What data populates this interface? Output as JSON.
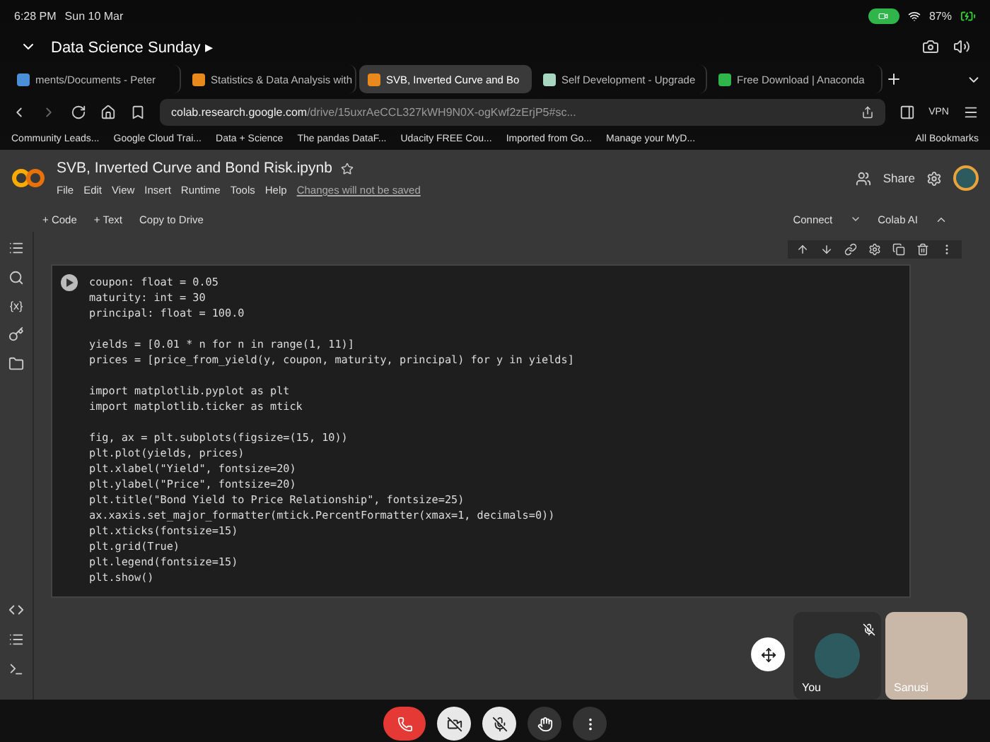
{
  "status_bar": {
    "time": "6:28 PM",
    "date": "Sun 10 Mar",
    "battery": "87%"
  },
  "meeting": {
    "title": "Data Science Sunday ▸"
  },
  "tabs": [
    {
      "label": "ments/Documents - Peter",
      "selected": false
    },
    {
      "label": "Statistics & Data Analysis with",
      "selected": false
    },
    {
      "label": "SVB, Inverted Curve and Bo",
      "selected": true
    },
    {
      "label": "Self Development - Upgrade",
      "selected": false
    },
    {
      "label": "Free Download | Anaconda",
      "selected": false
    }
  ],
  "address": {
    "domain": "colab.research.google.com",
    "path": "/drive/15uxrAeCCL327kWH9N0X-ogKwf2zErjP5#sc...",
    "vpn": "VPN"
  },
  "bookmarks": [
    "Community Leads...",
    "Google Cloud Trai...",
    "Data + Science",
    "The pandas DataF...",
    "Udacity FREE Cou...",
    "Imported from Go...",
    "Manage your MyD...",
    "All Bookmarks"
  ],
  "notebook": {
    "title": "SVB, Inverted Curve and Bond Risk.ipynb",
    "menu": [
      "File",
      "Edit",
      "View",
      "Insert",
      "Runtime",
      "Tools",
      "Help"
    ],
    "notice": "Changes will not be saved",
    "share": "Share"
  },
  "toolbar": {
    "left": [
      "+ Code",
      "+ Text",
      "Copy to Drive"
    ],
    "connect": "Connect",
    "ai": "Colab AI"
  },
  "sidebar_label": "{x}",
  "code_blocks": [
    [
      "coupon: float = 0.05",
      "maturity: int = 30",
      "principal: float = 100.0"
    ],
    [
      "yields = [0.01 * n for n in range(1, 11)]",
      "prices = [price_from_yield(y, coupon, maturity, principal) for y in yields]"
    ],
    [
      "import matplotlib.pyplot as plt",
      "import matplotlib.ticker as mtick"
    ],
    [
      "fig, ax = plt.subplots(figsize=(15, 10))",
      "plt.plot(yields, prices)",
      "plt.xlabel(\"Yield\", fontsize=20)",
      "plt.ylabel(\"Price\", fontsize=20)",
      "plt.title(\"Bond Yield to Price Relationship\", fontsize=25)",
      "ax.xaxis.set_major_formatter(mtick.PercentFormatter(xmax=1, decimals=0))",
      "plt.xticks(fontsize=15)",
      "plt.grid(True)",
      "plt.legend(fontsize=15)",
      "plt.show()"
    ]
  ],
  "participants": [
    {
      "name": "You",
      "kind": "avatar",
      "muted": true
    },
    {
      "name": "Sanusi",
      "kind": "video",
      "muted": false
    }
  ],
  "call_controls": {
    "camera_off": true,
    "mic_off": true
  }
}
